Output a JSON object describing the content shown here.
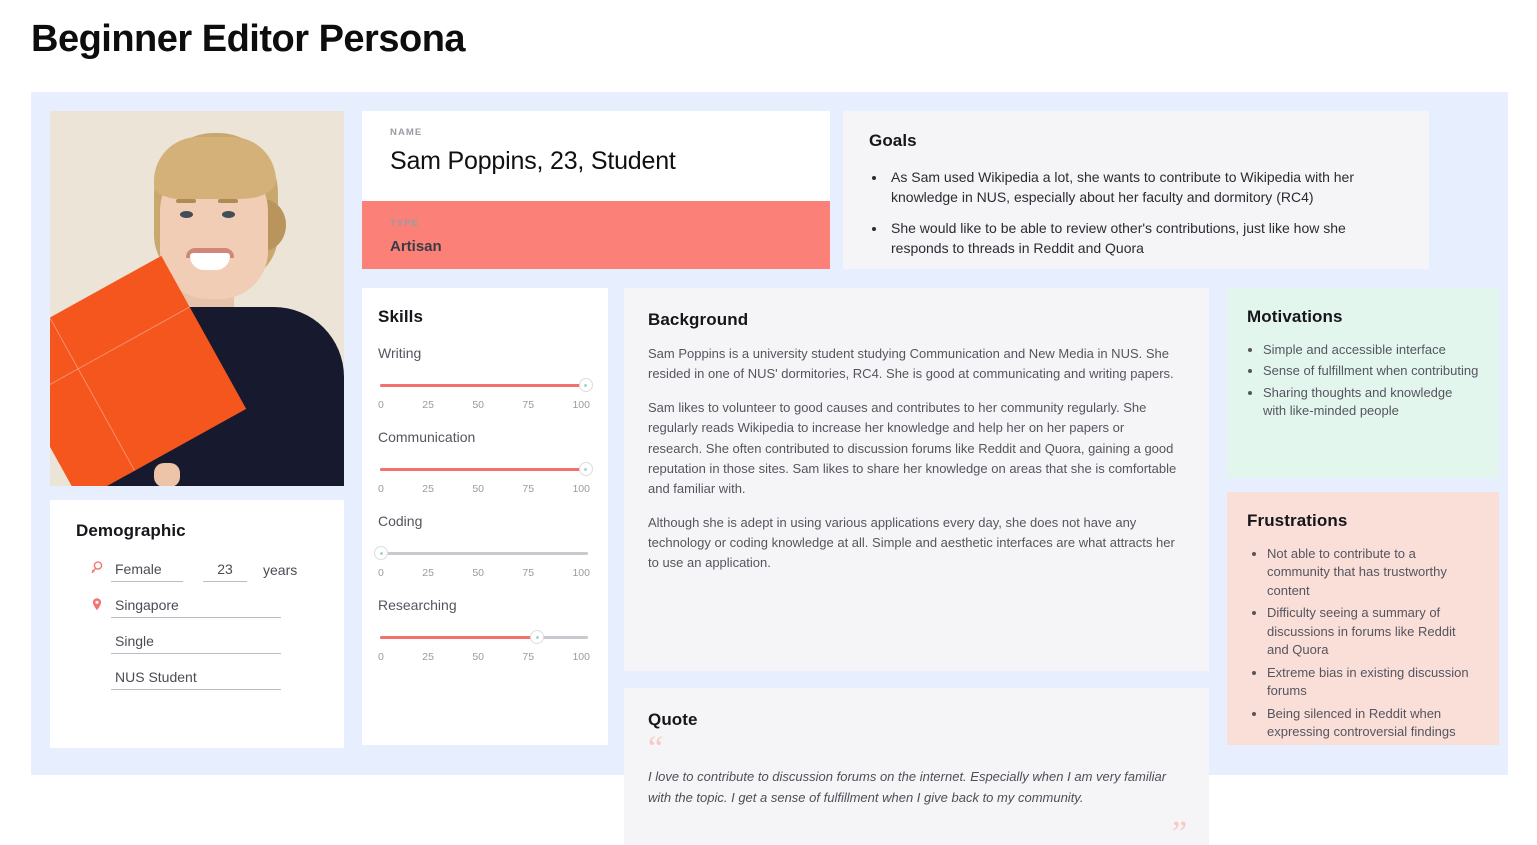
{
  "page_title": "Beginner Editor Persona",
  "colors": {
    "board_bg": "#e7eefd",
    "type_bg": "#fb8178",
    "accent": "#f4706b",
    "motivations_bg": "#e3f6ee",
    "frustrations_bg": "#fadfd8"
  },
  "photo": {
    "alt": "portrait-of-smiling-young-woman-holding-orange-folder"
  },
  "name_card": {
    "label": "NAME",
    "value": "Sam Poppins, 23, Student"
  },
  "type_card": {
    "label": "TYPE",
    "value": "Artisan"
  },
  "goals": {
    "title": "Goals",
    "items": [
      "As Sam used Wikipedia a lot, she wants to contribute to Wikipedia with her knowledge in NUS, especially about her faculty and dormitory (RC4)",
      "She would like to be able to review other's contributions, just like how she responds to threads in Reddit and Quora"
    ]
  },
  "demographic": {
    "title": "Demographic",
    "gender": "Female",
    "age": "23",
    "age_unit": "years",
    "location": "Singapore",
    "marital_status": "Single",
    "occupation": "NUS Student",
    "gender_icon": "female-symbol-icon",
    "location_icon": "location-pin-icon"
  },
  "skills": {
    "title": "Skills",
    "ticks": [
      "0",
      "25",
      "50",
      "75",
      "100"
    ],
    "items": [
      {
        "label": "Writing",
        "value": 98
      },
      {
        "label": "Communication",
        "value": 98
      },
      {
        "label": "Coding",
        "value": 0
      },
      {
        "label": "Researching",
        "value": 75
      }
    ]
  },
  "background": {
    "title": "Background",
    "paragraphs": [
      "Sam Poppins is a university student studying Communication and New Media in NUS. She resided in one of NUS' dormitories, RC4. She is good at communicating and writing papers.",
      "Sam likes to volunteer to good causes and contributes to her community regularly. She regularly reads Wikipedia to increase her knowledge and help her on her papers or research. She often contributed to discussion forums like Reddit and Quora, gaining a good reputation in those sites. Sam likes to share her knowledge on areas that she is comfortable and familiar with.",
      "Although she is adept in using various applications every day, she does not have any technology or coding knowledge at all. Simple and aesthetic interfaces are what attracts her to use an application."
    ]
  },
  "quote": {
    "title": "Quote",
    "open_mark": "“",
    "close_mark": "“",
    "text": "I love to contribute to discussion forums on the internet. Especially when I am very familiar with the topic. I get a sense of fulfillment when I give back to my community."
  },
  "motivations": {
    "title": "Motivations",
    "items": [
      "Simple and accessible interface",
      "Sense of fulfillment when contributing",
      "Sharing thoughts and knowledge with like-minded people"
    ]
  },
  "frustrations": {
    "title": "Frustrations",
    "items": [
      "Not able to contribute to a community that has trustworthy content",
      "Difficulty seeing a summary of discussions in forums like Reddit and Quora",
      "Extreme bias in existing discussion forums",
      "Being silenced in Reddit when expressing controversial findings"
    ]
  }
}
